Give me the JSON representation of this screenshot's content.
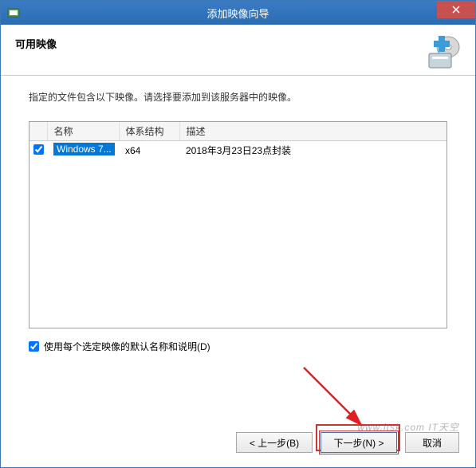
{
  "titlebar": {
    "title": "添加映像向导"
  },
  "header": {
    "title": "可用映像"
  },
  "instruction": "指定的文件包含以下映像。请选择要添加到该服务器中的映像。",
  "table": {
    "headers": {
      "name": "名称",
      "arch": "体系结构",
      "desc": "描述"
    },
    "rows": [
      {
        "checked": true,
        "name": "Windows 7...",
        "arch": "x64",
        "desc": "2018年3月23日23点封装"
      }
    ]
  },
  "useDefault": {
    "label": "使用每个选定映像的默认名称和说明(D)",
    "checked": true
  },
  "buttons": {
    "back": "< 上一步(B)",
    "next": "下一步(N) >",
    "cancel": "取消"
  },
  "watermark": "www.itsk.com IT天空"
}
